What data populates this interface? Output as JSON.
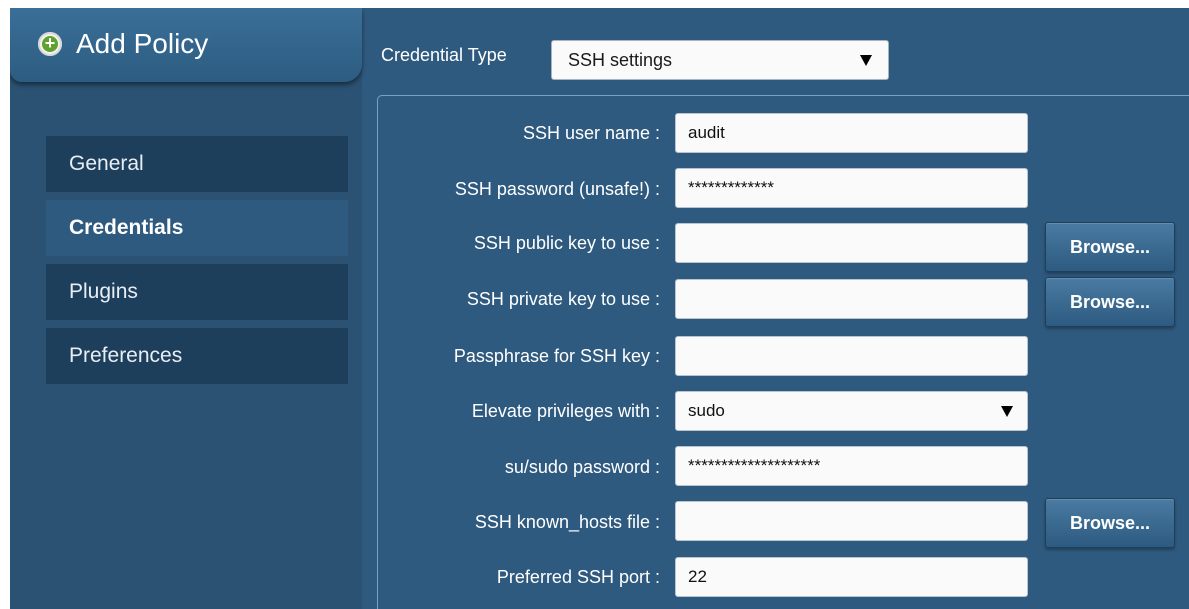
{
  "header": {
    "title": "Add Policy",
    "icon": "add-circle-icon"
  },
  "nav": {
    "items": [
      {
        "label": "General",
        "active": false
      },
      {
        "label": "Credentials",
        "active": true
      },
      {
        "label": "Plugins",
        "active": false
      },
      {
        "label": "Preferences",
        "active": false
      }
    ]
  },
  "credential_type": {
    "label": "Credential Type",
    "value": "SSH settings"
  },
  "form": {
    "rows": [
      {
        "label": "SSH user name :",
        "value": "audit",
        "type": "text"
      },
      {
        "label": "SSH password (unsafe!) :",
        "value": "*************",
        "type": "password"
      },
      {
        "label": "SSH public key to use :",
        "value": "",
        "type": "file",
        "button": "Browse..."
      },
      {
        "label": "SSH private key to use :",
        "value": "",
        "type": "file",
        "button": "Browse..."
      },
      {
        "label": "Passphrase for SSH key :",
        "value": "",
        "type": "password"
      },
      {
        "label": "Elevate privileges with :",
        "value": "sudo",
        "type": "select"
      },
      {
        "label": "su/sudo password :",
        "value": "********************",
        "type": "password"
      },
      {
        "label": "SSH known_hosts file :",
        "value": "",
        "type": "file",
        "button": "Browse..."
      },
      {
        "label": "Preferred SSH port :",
        "value": "22",
        "type": "text"
      }
    ]
  },
  "colors": {
    "background": "#2f5a7f",
    "sidebar": "#2b5273",
    "nav_item": "#1d3f5c",
    "accent_green": "#5fa32e"
  }
}
